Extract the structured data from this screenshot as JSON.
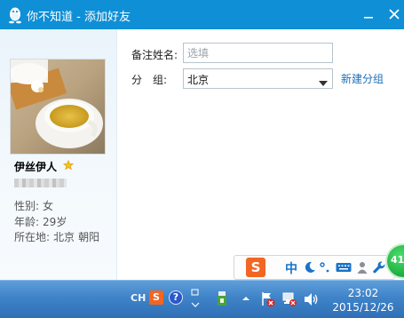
{
  "window": {
    "title": "你不知道 - 添加好友"
  },
  "profile": {
    "nickname": "伊丝伊人",
    "gender_label": "性别:",
    "gender": "女",
    "age_label": "年龄:",
    "age": "29岁",
    "location_label": "所在地:",
    "location_province": "北京",
    "location_city": "朝阳"
  },
  "form": {
    "remark_label": "备注姓名:",
    "remark_placeholder": "选填",
    "remark_value": "",
    "group_label": "分　组:",
    "group_value": "北京",
    "new_group_link": "新建分组"
  },
  "ime_toolbar": {
    "logo_letter": "S",
    "mode_char": "中",
    "icons": [
      "moon-icon",
      "punctuation-icon",
      "keyboard-icon",
      "user-icon",
      "wrench-icon"
    ]
  },
  "floating_badge": {
    "text": "41"
  },
  "taskbar": {
    "language": "CH",
    "sogou_letter": "S",
    "help_symbol": "?",
    "time": "23:02",
    "date": "2015/12/26"
  },
  "colors": {
    "titlebar": "#0f8fd6",
    "link": "#1d6fb8",
    "taskbar": "#3f83c8",
    "ime_brand": "#f26522",
    "badge": "#22b445"
  }
}
